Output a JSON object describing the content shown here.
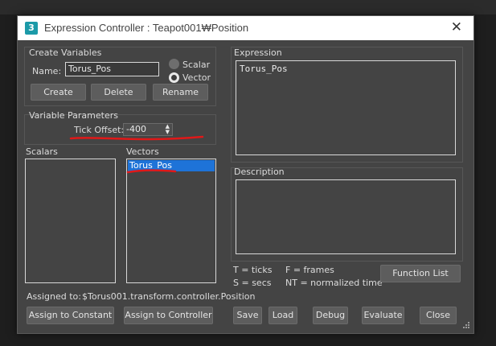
{
  "window": {
    "title": "Expression Controller : Teapot001₩Position",
    "app_icon": "3"
  },
  "create_variables": {
    "group_label": "Create Variables",
    "name_label": "Name:",
    "name_value": "Torus_Pos",
    "radio_scalar": "Scalar",
    "radio_vector": "Vector",
    "selected_type": "Vector",
    "create_btn": "Create",
    "delete_btn": "Delete",
    "rename_btn": "Rename"
  },
  "variable_parameters": {
    "group_label": "Variable Parameters",
    "tick_offset_label": "Tick Offset:",
    "tick_offset_value": "-400"
  },
  "scalars": {
    "label": "Scalars",
    "items": []
  },
  "vectors": {
    "label": "Vectors",
    "items": [
      "Torus_Pos"
    ],
    "selected": "Torus_Pos"
  },
  "expression": {
    "label": "Expression",
    "text": "Torus_Pos"
  },
  "description": {
    "label": "Description",
    "text": ""
  },
  "legend": {
    "ticks": "T = ticks",
    "frames": "F = frames",
    "secs": "S = secs",
    "normalized": "NT = normalized time"
  },
  "function_list_btn": "Function List",
  "assigned": {
    "label": "Assigned to:",
    "value": "$Torus001.transform.controller.Position"
  },
  "buttons": {
    "assign_constant": "Assign to Constant",
    "assign_controller": "Assign to Controller",
    "save": "Save",
    "load": "Load",
    "debug": "Debug",
    "evaluate": "Evaluate",
    "close": "Close"
  },
  "colors": {
    "annotation": "#e01818",
    "selection": "#1e73d8",
    "window_bg": "#444444"
  }
}
